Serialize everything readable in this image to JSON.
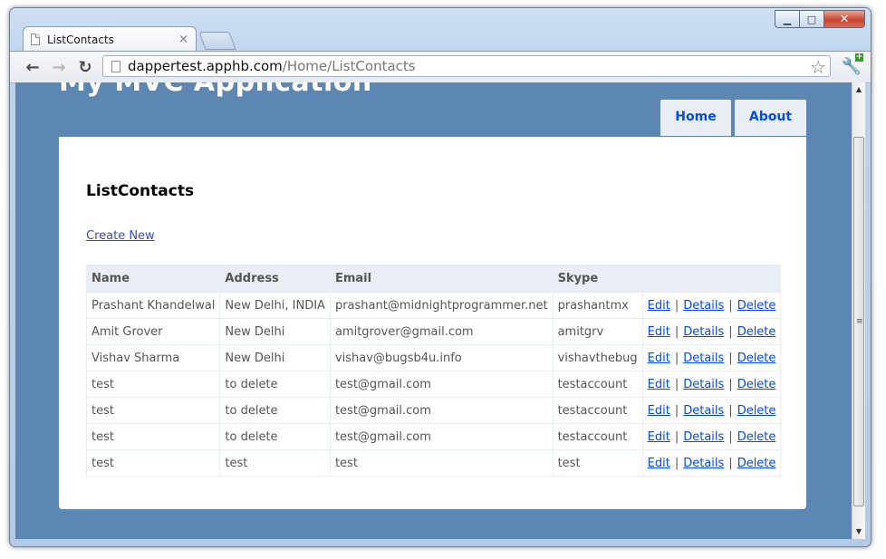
{
  "browser": {
    "tab_title": "ListContacts",
    "tab_close": "×",
    "url_host": "dappertest.apphb.com",
    "url_path": "/Home/ListContacts",
    "back_glyph": "←",
    "forward_glyph": "→",
    "reload_glyph": "↻",
    "star_glyph": "☆",
    "wrench_glyph": "🔧",
    "minimize_glyph": "▁",
    "maximize_glyph": "□",
    "close_glyph": "✕",
    "extension_badge": "+"
  },
  "site": {
    "title": "My MVC Application",
    "menu": [
      {
        "label": "Home"
      },
      {
        "label": "About"
      }
    ]
  },
  "page": {
    "heading": "ListContacts",
    "create_link": "Create New",
    "table": {
      "headers": [
        "Name",
        "Address",
        "Email",
        "Skype",
        ""
      ],
      "rows": [
        {
          "name": "Prashant Khandelwal",
          "address": "New Delhi, INDIA",
          "email": "prashant@midnightprogrammer.net",
          "skype": "prashantmx"
        },
        {
          "name": "Amit Grover",
          "address": "New Delhi",
          "email": "amitgrover@gmail.com",
          "skype": "amitgrv"
        },
        {
          "name": "Vishav Sharma",
          "address": "New Delhi",
          "email": "vishav@bugsb4u.info",
          "skype": "vishavthebug"
        },
        {
          "name": "test",
          "address": "to delete",
          "email": "test@gmail.com",
          "skype": "testaccount"
        },
        {
          "name": "test",
          "address": "to delete",
          "email": "test@gmail.com",
          "skype": "testaccount"
        },
        {
          "name": "test",
          "address": "to delete",
          "email": "test@gmail.com",
          "skype": "testaccount"
        },
        {
          "name": "test",
          "address": "test",
          "email": "test",
          "skype": "test"
        }
      ],
      "actions": {
        "edit": "Edit",
        "details": "Details",
        "delete": "Delete",
        "separator": "|"
      }
    }
  },
  "colors": {
    "page_background": "#5c87b2",
    "link": "#034af3",
    "header_cell": "#e8eef4"
  }
}
